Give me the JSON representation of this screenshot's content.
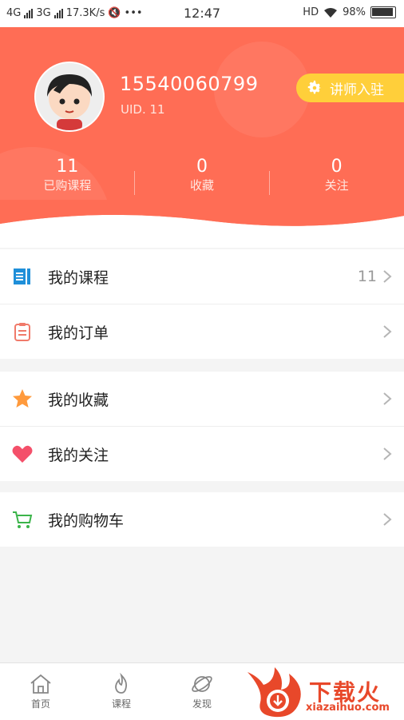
{
  "status_bar": {
    "net1": "4G",
    "net2": "3G",
    "speed": "17.3K/s",
    "time": "12:47",
    "hd": "HD",
    "battery": "98%"
  },
  "profile": {
    "phone": "15540060799",
    "uid": "UID. 11",
    "lecturer_button": "讲师入驻"
  },
  "stats": [
    {
      "value": "11",
      "label": "已购课程"
    },
    {
      "value": "0",
      "label": "收藏"
    },
    {
      "value": "0",
      "label": "关注"
    }
  ],
  "menu": {
    "courses": {
      "label": "我的课程",
      "count": "11"
    },
    "orders": {
      "label": "我的订单"
    },
    "favorites": {
      "label": "我的收藏"
    },
    "following": {
      "label": "我的关注"
    },
    "cart": {
      "label": "我的购物车"
    }
  },
  "tabs": [
    {
      "label": "首页",
      "icon": "home-icon"
    },
    {
      "label": "课程",
      "icon": "flame-icon"
    },
    {
      "label": "发现",
      "icon": "planet-icon"
    }
  ],
  "watermark": {
    "title": "下载火",
    "site": "xiazaihuo.com"
  },
  "colors": {
    "header": "#ff6d55",
    "lecturer": "#ffcf3a",
    "courses_icon": "#1f8fd9",
    "orders_icon": "#f07a6a",
    "favorites_icon": "#ff9a3c",
    "following_icon": "#f4506a",
    "cart_icon": "#3bb44a"
  }
}
